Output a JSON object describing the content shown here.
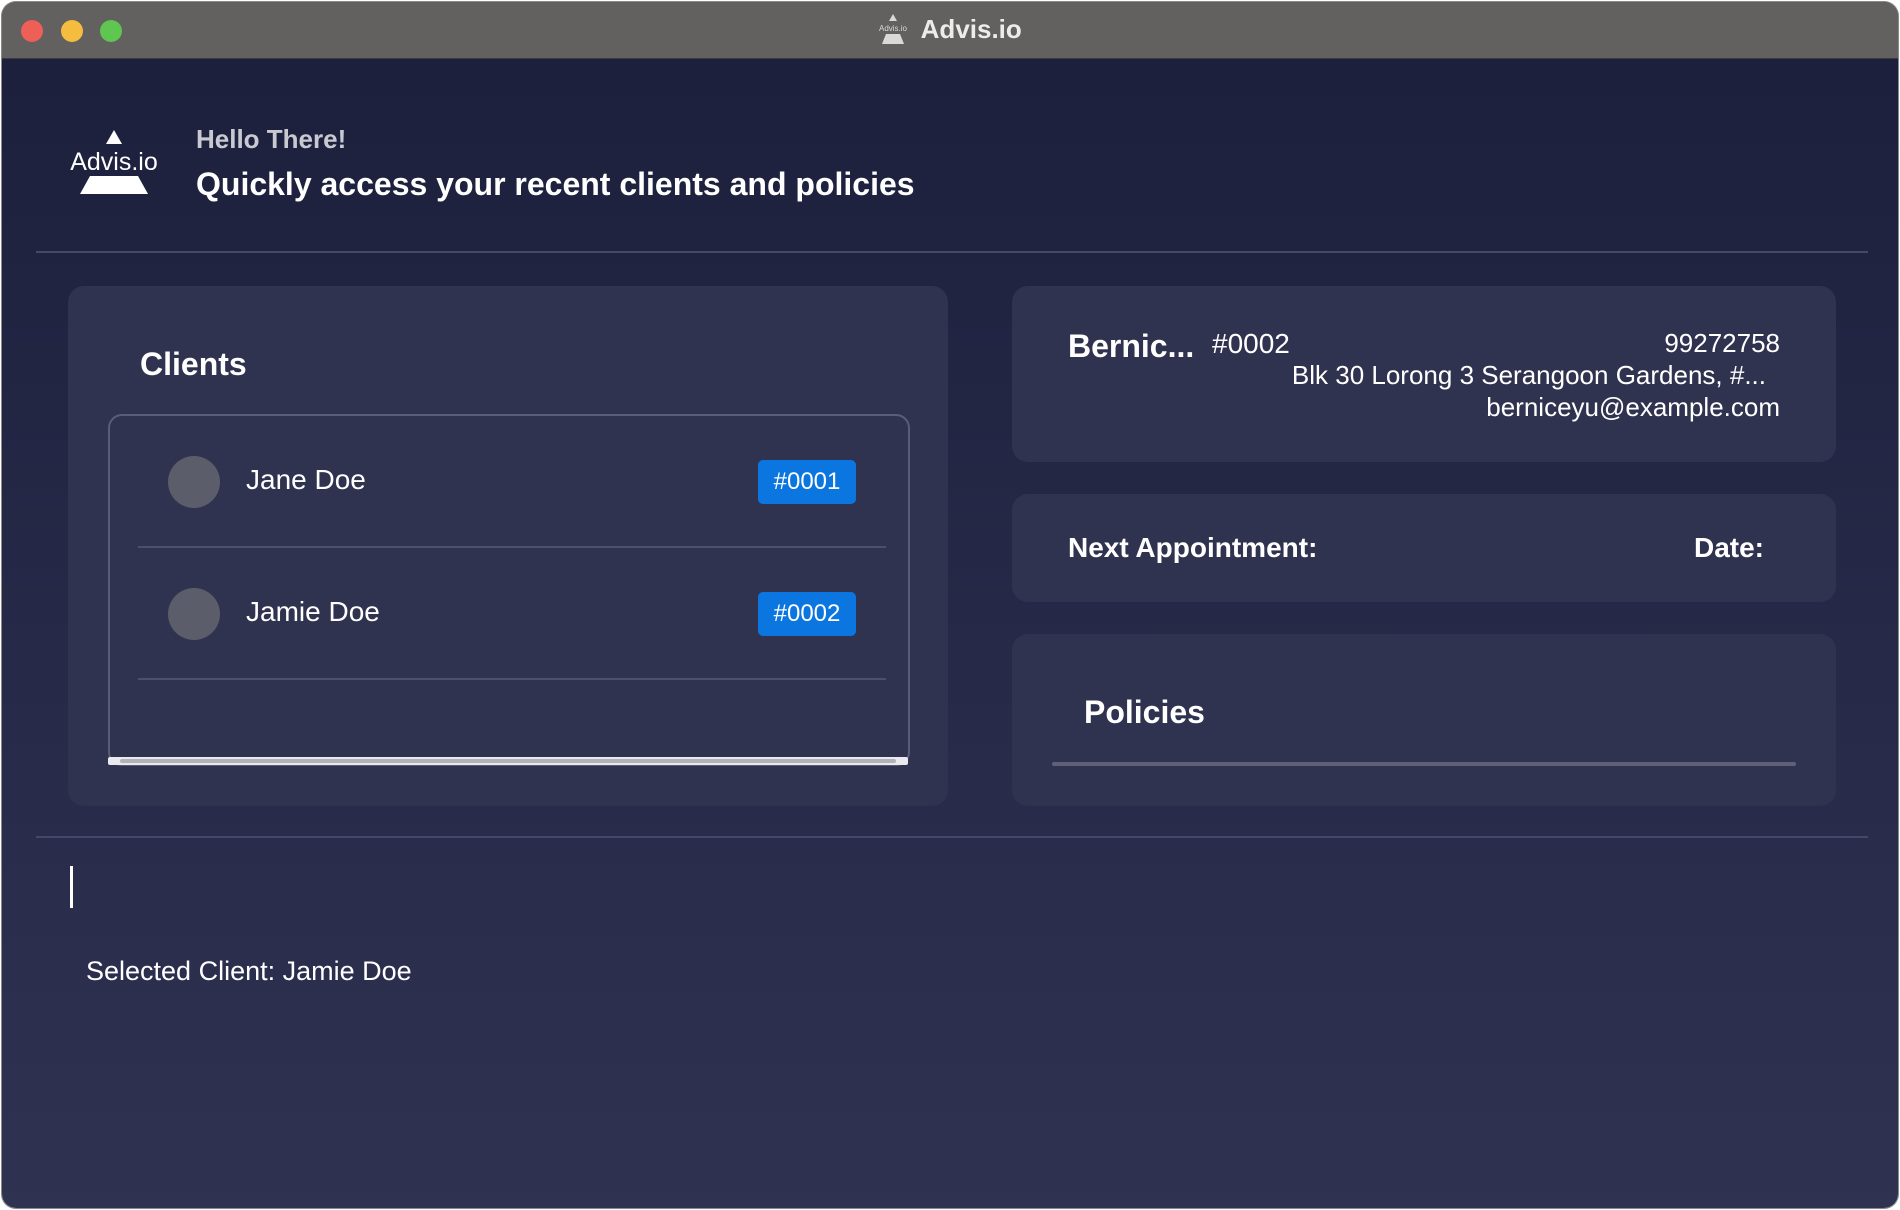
{
  "window": {
    "title": "Advis.io",
    "controls": [
      "close",
      "minimize",
      "maximize"
    ]
  },
  "header": {
    "logo_text": "Advis.io",
    "greeting": "Hello There!",
    "subtitle": "Quickly access your recent clients and policies"
  },
  "clients": {
    "title": "Clients",
    "items": [
      {
        "name": "Jane Doe",
        "id": "#0001"
      },
      {
        "name": "Jamie Doe",
        "id": "#0002"
      }
    ]
  },
  "client_detail": {
    "name": "Bernic...",
    "id": "#0002",
    "phone": "99272758",
    "address": "Blk 30 Lorong 3 Serangoon Gardens, #...",
    "email": "berniceyu@example.com"
  },
  "appointment": {
    "label": "Next Appointment:",
    "date_label": "Date:"
  },
  "policies": {
    "title": "Policies"
  },
  "command": {
    "value": ""
  },
  "status": {
    "text": "Selected Client: Jamie Doe"
  },
  "colors": {
    "accent": "#0b76e0",
    "background": "#1c1f3b",
    "panel": "#30334f"
  }
}
